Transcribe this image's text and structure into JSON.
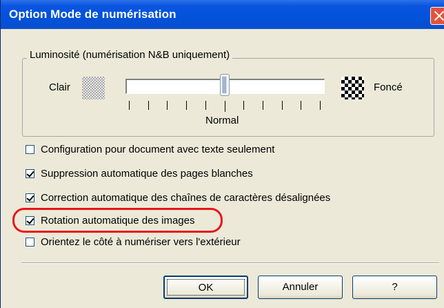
{
  "window": {
    "title": "Option Mode de numérisation"
  },
  "brightness": {
    "group_label": "Luminosité (numérisation N&B uniquement)",
    "left_label": "Clair",
    "right_label": "Foncé",
    "center_label": "Normal",
    "slider_position_fraction": 0.5,
    "tick_count": 11
  },
  "options": [
    {
      "label": "Configuration pour document avec texte seulement",
      "checked": false
    },
    {
      "label": "Suppression automatique des pages blanches",
      "checked": true
    },
    {
      "label": "Correction automatique des chaînes de caractères désalignées",
      "checked": true
    },
    {
      "label": "Rotation automatique des images",
      "checked": true,
      "highlighted": true
    },
    {
      "label": "Orientez le côté à numériser vers l'extérieur",
      "checked": false
    }
  ],
  "buttons": {
    "ok": "OK",
    "cancel": "Annuler",
    "help": "?"
  },
  "colors": {
    "titlebar": "#0a55e0",
    "highlight": "#e8141a",
    "dialog_bg": "#ece9d8"
  }
}
